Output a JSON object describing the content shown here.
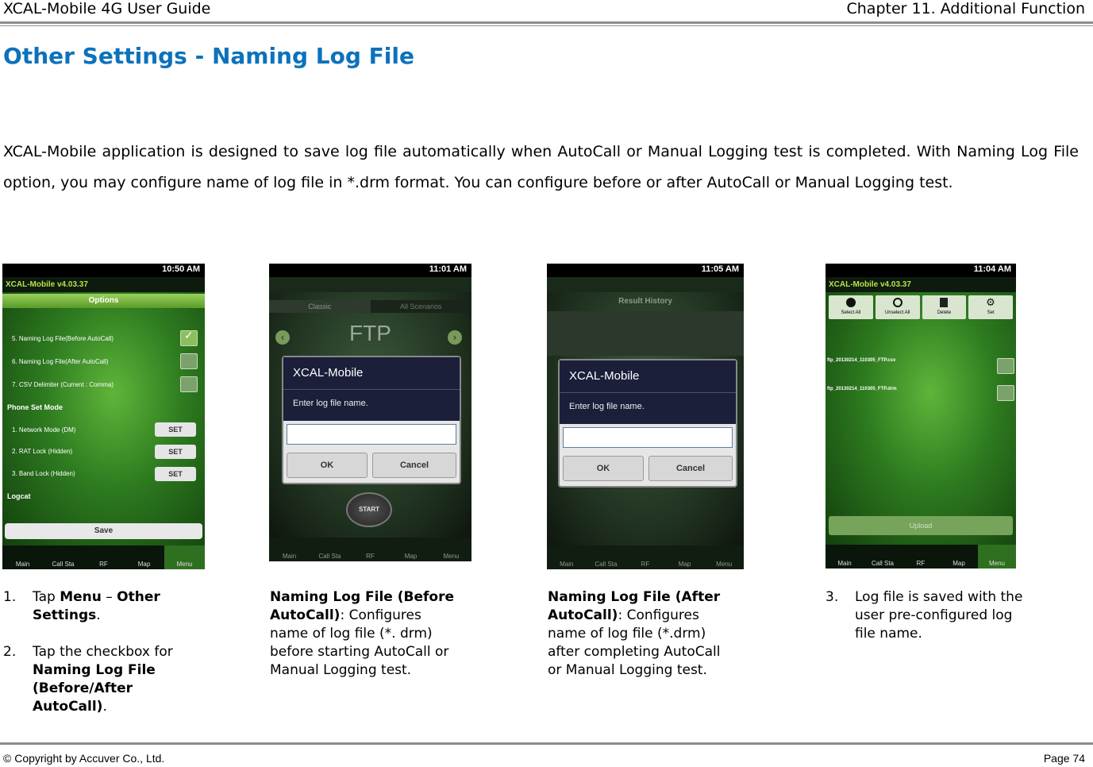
{
  "header": {
    "left": "XCAL-Mobile 4G User Guide",
    "right": "Chapter 11. Additional Function"
  },
  "title": "Other Settings - Naming Log File",
  "intro": "XCAL-Mobile application is designed to save log file automatically when AutoCall or Manual Logging test is completed. With Naming Log File option, you may configure name of log file in *.drm format. You can configure before or after AutoCall or Manual Logging test.",
  "screens": {
    "s1": {
      "time": "10:50 AM",
      "app": "XCAL-Mobile v4.03.37",
      "options_title": "Options",
      "rows": [
        "5. Naming Log File(Before AutoCall)",
        "6. Naming Log File(After AutoCall)",
        "7. CSV Delimiter (Current : Comma)"
      ],
      "section_phone": "Phone Set Mode",
      "phone_rows": [
        "1. Network Mode (DM)",
        "2. RAT Lock (Hidden)",
        "3. Band Lock (Hidden)"
      ],
      "set_label": "SET",
      "section_logcat": "Logcat",
      "save": "Save",
      "nav": [
        "Main",
        "Call Sta",
        "RF",
        "Map",
        "Menu"
      ]
    },
    "s2": {
      "time": "11:01 AM",
      "tabs": [
        "Classic",
        "All Scenarios"
      ],
      "ftp": "FTP",
      "dialog_title": "XCAL-Mobile",
      "dialog_msg": "Enter log file name.",
      "ok": "OK",
      "cancel": "Cancel",
      "start": "START",
      "nav": [
        "Main",
        "Call Sta",
        "RF",
        "Map",
        "Menu"
      ]
    },
    "s3": {
      "time": "11:05 AM",
      "result": "Result History",
      "dialog_title": "XCAL-Mobile",
      "dialog_msg": "Enter log file name.",
      "ok": "OK",
      "cancel": "Cancel",
      "nav": [
        "Main",
        "Call Sta",
        "RF",
        "Map",
        "Menu"
      ]
    },
    "s4": {
      "time": "11:04 AM",
      "app": "XCAL-Mobile v4.03.37",
      "toolbar": [
        "Select All",
        "Unselect All",
        "Delete",
        "Set"
      ],
      "files": [
        "ftp_20130214_110305_FTP.csv",
        "ftp_20130214_110305_FTP.drm"
      ],
      "upload": "Upload",
      "nav": [
        "Main",
        "Call Sta",
        "RF",
        "Map",
        "Menu"
      ]
    }
  },
  "captions": {
    "c1": {
      "n1": "1.",
      "p1a": "Tap ",
      "p1b": "Menu",
      "p1c": " – ",
      "p1d": "Other",
      "p1e": "Settings",
      "p1f": ".",
      "n2": "2.",
      "p2a": "Tap the checkbox for",
      "p2b": "Naming Log File",
      "p2c": "(Before/After",
      "p2d": "AutoCall)",
      "p2e": "."
    },
    "c2": {
      "l1": "Naming Log File (Before",
      "l2b": "AutoCall)",
      "l2": ": Configures",
      "l3": "name of log file (*. drm)",
      "l4": "before starting AutoCall or",
      "l5": "Manual Logging test."
    },
    "c3": {
      "l1": "Naming Log File (After",
      "l2b": "AutoCall)",
      "l2": ": Configures",
      "l3": "name of log file (*.drm)",
      "l4": "after completing AutoCall",
      "l5": "or Manual Logging test."
    },
    "c4": {
      "n": "3.",
      "l1": "Log file is saved with the",
      "l2": "user pre-configured log",
      "l3": "file name."
    }
  },
  "footer": {
    "left": "© Copyright by Accuver Co., Ltd.",
    "right": "Page 74"
  }
}
